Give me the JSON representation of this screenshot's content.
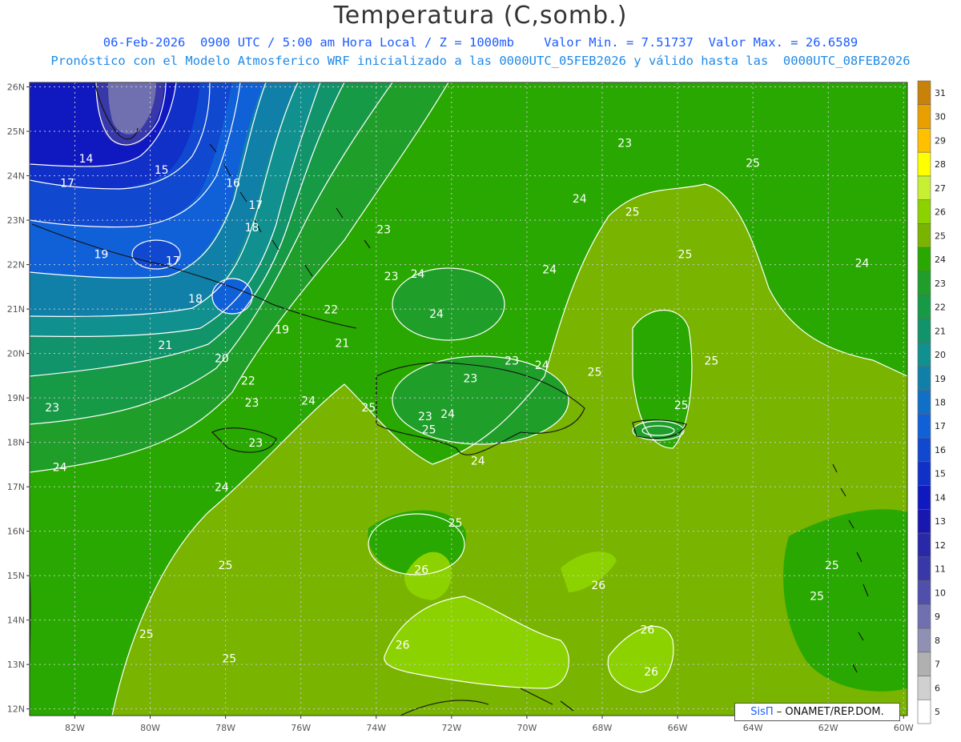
{
  "title": "Temperatura (C,somb.)",
  "subtitle_1": "06-Feb-2026  0900 UTC / 5:00 am Hora Local / Z = 1000mb    Valor Min. = 7.51737  Valor Max. = 26.6589",
  "subtitle_2": "Pronóstico con el Modelo Atmosferico WRF inicializado a las 0000UTC_05FEB2026 y válido hasta las  0000UTC_08FEB2026",
  "credit": {
    "brand": "SisΠ",
    "text": "– ONAMET/REP.DOM."
  },
  "map": {
    "lon_range": [
      -83.2,
      -59.9
    ],
    "lat_range": [
      11.85,
      26.1
    ],
    "lat_ticks": [
      "26N",
      "25N",
      "24N",
      "23N",
      "22N",
      "21N",
      "20N",
      "19N",
      "18N",
      "17N",
      "16N",
      "15N",
      "14N",
      "13N",
      "12N"
    ],
    "lat_values": [
      26,
      25,
      24,
      23,
      22,
      21,
      20,
      19,
      18,
      17,
      16,
      15,
      14,
      13,
      12
    ],
    "lon_ticks": [
      "82W",
      "80W",
      "78W",
      "76W",
      "74W",
      "72W",
      "70W",
      "68W",
      "66W",
      "64W",
      "62W",
      "60W"
    ],
    "lon_values": [
      -82,
      -80,
      -78,
      -76,
      -74,
      -72,
      -70,
      -68,
      -66,
      -64,
      -62,
      -60
    ]
  },
  "colorbar": {
    "levels": [
      "31",
      "30",
      "29",
      "28",
      "27",
      "26",
      "25",
      "24",
      "23",
      "22",
      "21",
      "20",
      "19",
      "18",
      "17",
      "16",
      "15",
      "14",
      "13",
      "12",
      "11",
      "10",
      "9",
      "8",
      "7",
      "6",
      "5"
    ],
    "colors": [
      "#c8820a",
      "#e8a000",
      "#ffc000",
      "#ffff00",
      "#c8f032",
      "#8cd200",
      "#78b400",
      "#28a800",
      "#1f9e2a",
      "#169a46",
      "#12946a",
      "#10908e",
      "#1080a8",
      "#1070c8",
      "#1060d8",
      "#1048d0",
      "#1030c8",
      "#1018c0",
      "#1818b0",
      "#2828a8",
      "#3838a8",
      "#5050ac",
      "#7070b0",
      "#9090b4",
      "#b0b0b0",
      "#d0d0d0",
      "#ffffff"
    ]
  },
  "contour_labels": [
    {
      "text": "14",
      "lon": -81.7,
      "lat": 24.3
    },
    {
      "text": "15",
      "lon": -79.7,
      "lat": 24.05
    },
    {
      "text": "16",
      "lon": -77.8,
      "lat": 23.75
    },
    {
      "text": "17",
      "lon": -82.2,
      "lat": 23.75
    },
    {
      "text": "17",
      "lon": -77.2,
      "lat": 23.25
    },
    {
      "text": "18",
      "lon": -77.3,
      "lat": 22.75
    },
    {
      "text": "19",
      "lon": -81.3,
      "lat": 22.15
    },
    {
      "text": "17",
      "lon": -79.4,
      "lat": 22.0
    },
    {
      "text": "18",
      "lon": -78.8,
      "lat": 21.15
    },
    {
      "text": "19",
      "lon": -76.5,
      "lat": 20.45
    },
    {
      "text": "21",
      "lon": -79.6,
      "lat": 20.1
    },
    {
      "text": "20",
      "lon": -78.1,
      "lat": 19.8
    },
    {
      "text": "22",
      "lon": -75.2,
      "lat": 20.9
    },
    {
      "text": "21",
      "lon": -74.9,
      "lat": 20.15
    },
    {
      "text": "22",
      "lon": -77.4,
      "lat": 19.3
    },
    {
      "text": "23",
      "lon": -82.6,
      "lat": 18.7
    },
    {
      "text": "23",
      "lon": -77.3,
      "lat": 18.8
    },
    {
      "text": "24",
      "lon": -75.8,
      "lat": 18.85
    },
    {
      "text": "23",
      "lon": -77.2,
      "lat": 17.9
    },
    {
      "text": "24",
      "lon": -82.4,
      "lat": 17.35
    },
    {
      "text": "24",
      "lon": -78.1,
      "lat": 16.9
    },
    {
      "text": "25",
      "lon": -74.2,
      "lat": 18.7
    },
    {
      "text": "23",
      "lon": -73.8,
      "lat": 22.7
    },
    {
      "text": "23",
      "lon": -73.6,
      "lat": 21.65
    },
    {
      "text": "24",
      "lon": -72.9,
      "lat": 21.7
    },
    {
      "text": "24",
      "lon": -72.4,
      "lat": 20.8
    },
    {
      "text": "24",
      "lon": -69.4,
      "lat": 21.8
    },
    {
      "text": "23",
      "lon": -71.5,
      "lat": 19.35
    },
    {
      "text": "23",
      "lon": -70.4,
      "lat": 19.75
    },
    {
      "text": "24",
      "lon": -69.6,
      "lat": 19.65
    },
    {
      "text": "23",
      "lon": -72.7,
      "lat": 18.5
    },
    {
      "text": "24",
      "lon": -72.1,
      "lat": 18.55
    },
    {
      "text": "25",
      "lon": -72.6,
      "lat": 18.2
    },
    {
      "text": "24",
      "lon": -71.3,
      "lat": 17.5
    },
    {
      "text": "24",
      "lon": -68.6,
      "lat": 23.4
    },
    {
      "text": "23",
      "lon": -67.4,
      "lat": 24.65
    },
    {
      "text": "25",
      "lon": -67.2,
      "lat": 23.1
    },
    {
      "text": "25",
      "lon": -64.0,
      "lat": 24.2
    },
    {
      "text": "25",
      "lon": -65.8,
      "lat": 22.15
    },
    {
      "text": "24",
      "lon": -61.1,
      "lat": 21.95
    },
    {
      "text": "25",
      "lon": -68.2,
      "lat": 19.5
    },
    {
      "text": "25",
      "lon": -65.1,
      "lat": 19.75
    },
    {
      "text": "25",
      "lon": -65.9,
      "lat": 18.75
    },
    {
      "text": "25",
      "lon": -71.9,
      "lat": 16.1
    },
    {
      "text": "25",
      "lon": -78.0,
      "lat": 15.15
    },
    {
      "text": "26",
      "lon": -72.8,
      "lat": 15.05
    },
    {
      "text": "26",
      "lon": -68.1,
      "lat": 14.7
    },
    {
      "text": "25",
      "lon": -61.9,
      "lat": 15.15
    },
    {
      "text": "25",
      "lon": -62.3,
      "lat": 14.45
    },
    {
      "text": "26",
      "lon": -66.8,
      "lat": 13.7
    },
    {
      "text": "26",
      "lon": -73.3,
      "lat": 13.35
    },
    {
      "text": "26",
      "lon": -66.7,
      "lat": 12.75
    },
    {
      "text": "25",
      "lon": -80.1,
      "lat": 13.6
    },
    {
      "text": "25",
      "lon": -77.9,
      "lat": 13.05
    }
  ]
}
